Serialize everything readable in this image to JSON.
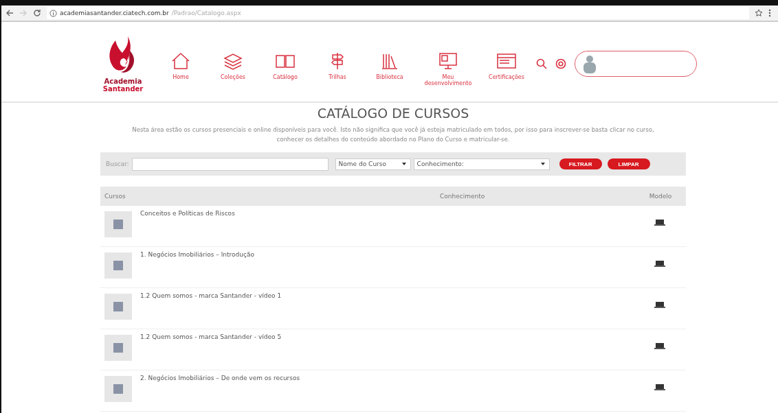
{
  "browser": {
    "url_host": "academiasantander.ciatech.com.br",
    "url_path": "/Padrao/Catalogo.aspx"
  },
  "logo": {
    "line1": "Academia",
    "line2": "Santander"
  },
  "nav": [
    {
      "label": "Home",
      "kind": "home"
    },
    {
      "label": "Coleções",
      "kind": "layers"
    },
    {
      "label": "Catálogo",
      "kind": "book"
    },
    {
      "label": "Trilhas",
      "kind": "signpost"
    },
    {
      "label": "Biblioteca",
      "kind": "library"
    },
    {
      "label": "Meu desenvolvimento",
      "kind": "monitor"
    },
    {
      "label": "Certificações",
      "kind": "certificate"
    }
  ],
  "title": "CATÁLOGO DE CURSOS",
  "intro": "Nesta área estão os cursos presenciais e online disponíveis para você. Isto não significa que você já esteja matriculado em todos, por isso para inscrever-se basta clicar no curso, conhecer os detalhes do conteúdo abordado no Plano do Curso e matricular-se.",
  "filter": {
    "label": "Buscar:",
    "select_1": "Nome do Curso",
    "select_2": "Conhecimento:",
    "buttons": [
      "FILTRAR",
      "LIMPAR"
    ]
  },
  "table": {
    "columns": [
      "Cursos",
      "Conhecimento",
      "Modelo"
    ],
    "rows": [
      {
        "course": "Conceitos e Políticas de Riscos"
      },
      {
        "course": "1. Negócios Imobiliários – Introdução"
      },
      {
        "course": "1.2 Quem somos - marca Santander - vídeo 1"
      },
      {
        "course": "1.2 Quem somos - marca Santander - vídeo 5"
      },
      {
        "course": "2. Negócios Imobiliários – De onde vem os recursos"
      }
    ]
  }
}
